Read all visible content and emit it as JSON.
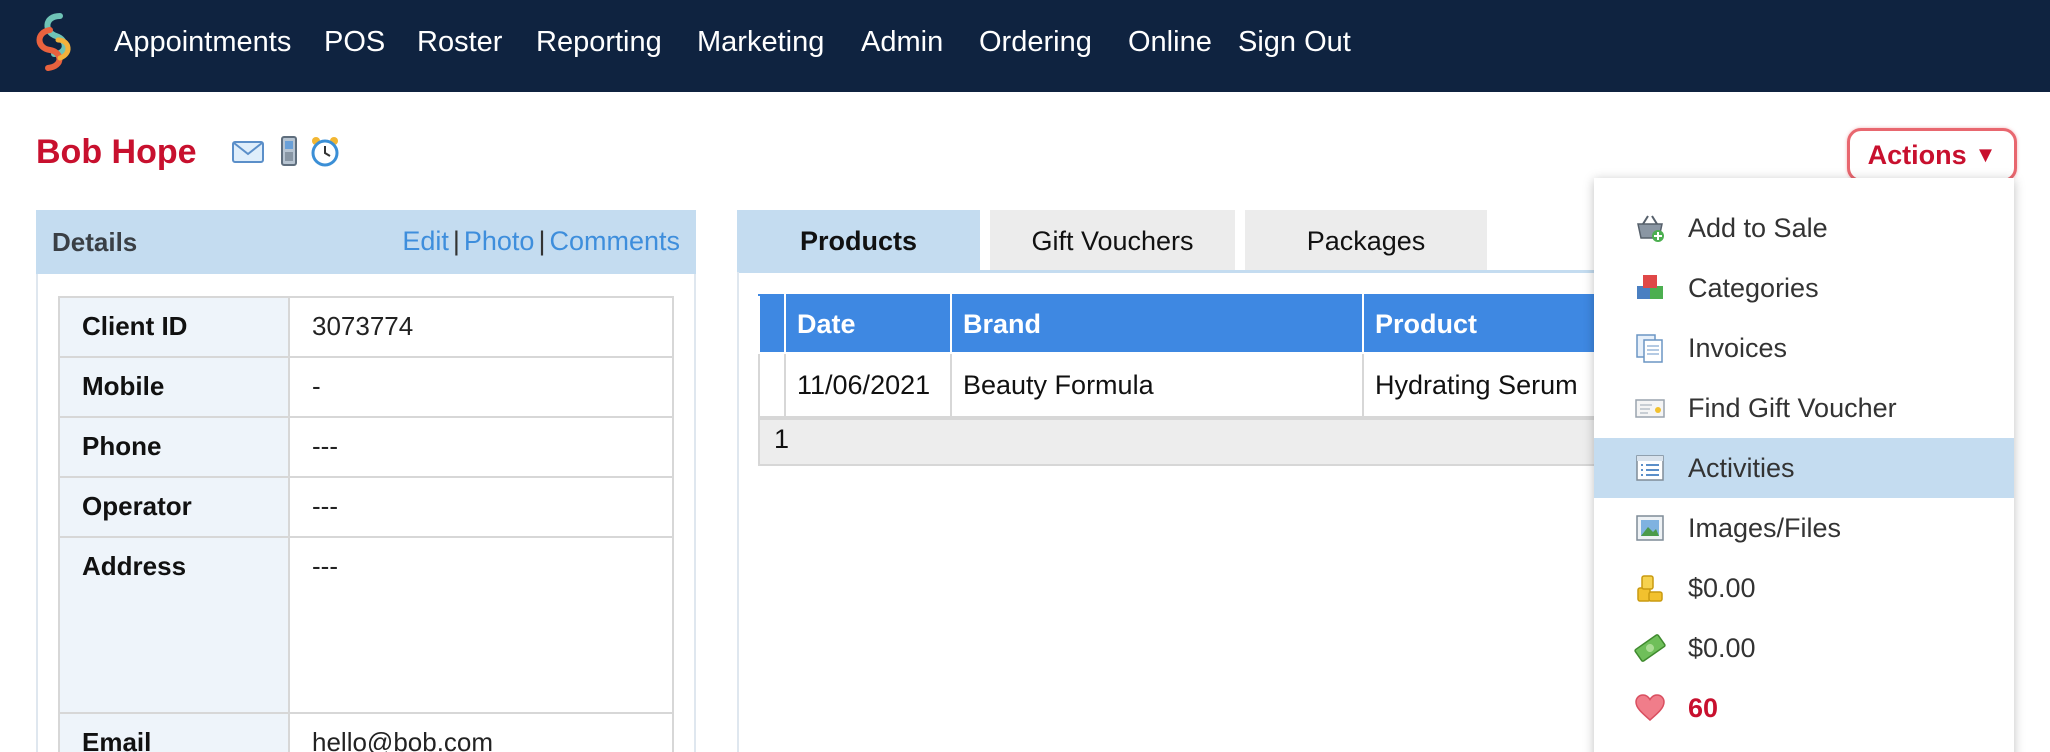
{
  "nav": {
    "items": [
      "Appointments",
      "POS",
      "Roster",
      "Reporting",
      "Marketing",
      "Admin",
      "Ordering",
      "Online",
      "Sign Out"
    ]
  },
  "client": {
    "name": "Bob Hope",
    "actions_label": "Actions",
    "actions_arrow": "▼"
  },
  "details": {
    "title": "Details",
    "links": {
      "edit": "Edit",
      "photo": "Photo",
      "comments": "Comments",
      "separator": "|"
    },
    "rows": [
      {
        "label": "Client ID",
        "value": "3073774"
      },
      {
        "label": "Mobile",
        "value": "-"
      },
      {
        "label": "Phone",
        "value": "---"
      },
      {
        "label": "Operator",
        "value": "---"
      },
      {
        "label": "Address",
        "value": "---"
      },
      {
        "label": "Email",
        "value": "hello@bob.com"
      }
    ]
  },
  "tabs": [
    "Products",
    "Gift Vouchers",
    "Packages"
  ],
  "products": {
    "columns": [
      "Date",
      "Brand",
      "Product"
    ],
    "rows": [
      {
        "date": "11/06/2021",
        "brand": "Beauty Formula",
        "product": "Hydrating Serum"
      }
    ],
    "pager": "1"
  },
  "menu": {
    "items": [
      {
        "label": "Add to Sale",
        "icon": "basket-add-icon"
      },
      {
        "label": "Categories",
        "icon": "cubes-icon"
      },
      {
        "label": "Invoices",
        "icon": "documents-icon"
      },
      {
        "label": "Find Gift Voucher",
        "icon": "gift-card-icon"
      },
      {
        "label": "Activities",
        "icon": "list-icon"
      },
      {
        "label": "Images/Files",
        "icon": "picture-icon"
      },
      {
        "label": "$0.00",
        "icon": "coins-icon"
      },
      {
        "label": "$0.00",
        "icon": "cash-icon"
      },
      {
        "label": "60",
        "icon": "heart-icon"
      }
    ]
  },
  "colors": {
    "nav_bg": "#0f2340",
    "brand_red": "#c8102e",
    "panel_header": "#c4dcf0",
    "table_header": "#3e88e2",
    "link_blue": "#3e8edc"
  }
}
